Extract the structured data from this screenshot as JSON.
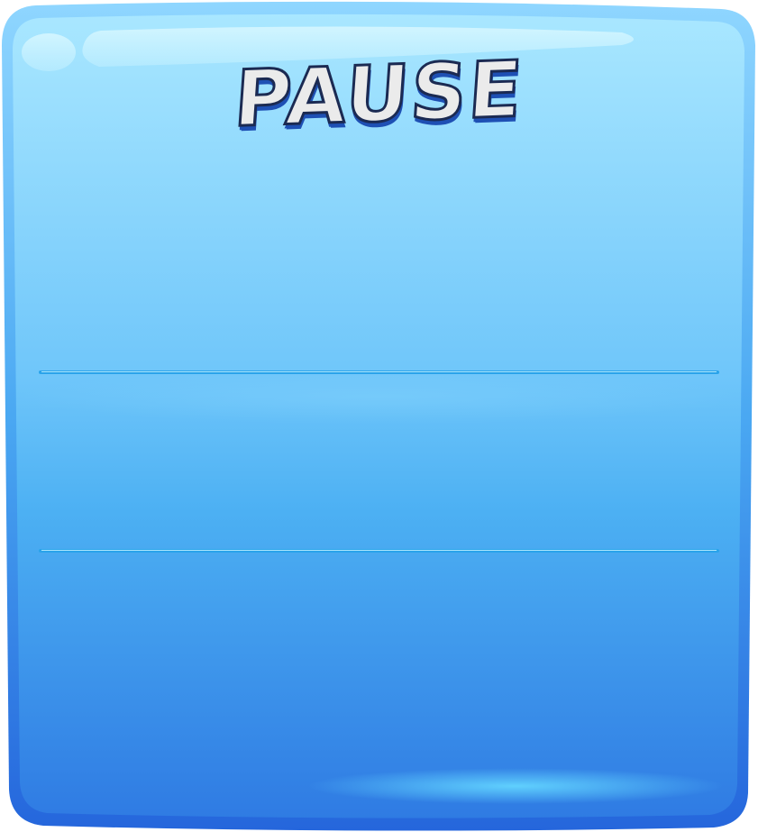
{
  "pause_panel": {
    "title": "PAUSE",
    "colors": {
      "panel_top": "#a9e7ff",
      "panel_middle": "#55b6f6",
      "panel_bottom": "#2f7be3",
      "border": "#2a6fe0",
      "title_fill": "#ebebeb",
      "title_outline": "#1b2a52",
      "title_shadow": "#1e50b4",
      "divider": "#2aa3ea"
    },
    "dividers": 2
  }
}
